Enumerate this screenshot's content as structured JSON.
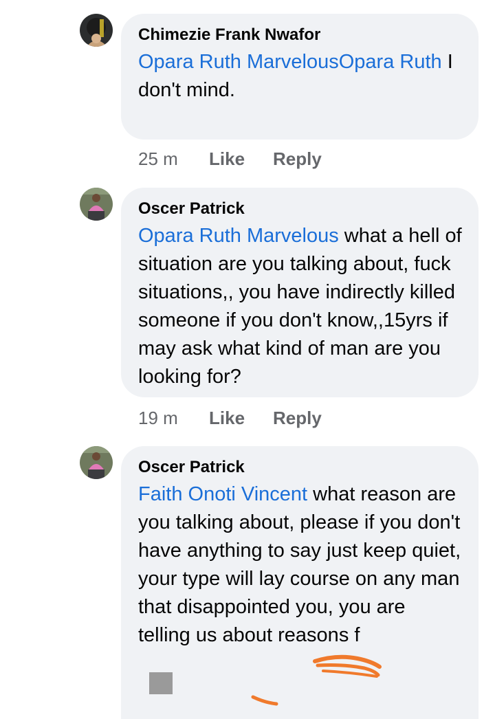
{
  "comments": [
    {
      "author": "Chimezie Frank Nwafor",
      "mention": "Opara Ruth MarvelousOpara Ruth",
      "text": " I don't mind.",
      "time": "25 m",
      "like_label": "Like",
      "reply_label": "Reply"
    },
    {
      "author": "Oscer Patrick",
      "mention": "Opara Ruth Marvelous",
      "text": " what a hell of situation are you talking about, fuck situations,, you have indirectly killed someone if you don't know,,15yrs if may ask what kind of man are you looking for?",
      "time": "19 m",
      "like_label": "Like",
      "reply_label": "Reply"
    },
    {
      "author": "Oscer Patrick",
      "mention": "Faith Onoti Vincent",
      "text": " what reason are you talking about, please if you don't have anything to say just keep quiet, your type will lay course on any man that disappointed you, you are telling us about reasons f",
      "time": "",
      "like_label": "",
      "reply_label": ""
    }
  ],
  "colors": {
    "mention": "#1a6ed8",
    "bubble": "#f0f2f5",
    "meta": "#65676b",
    "scribble": "#f07a2c"
  }
}
